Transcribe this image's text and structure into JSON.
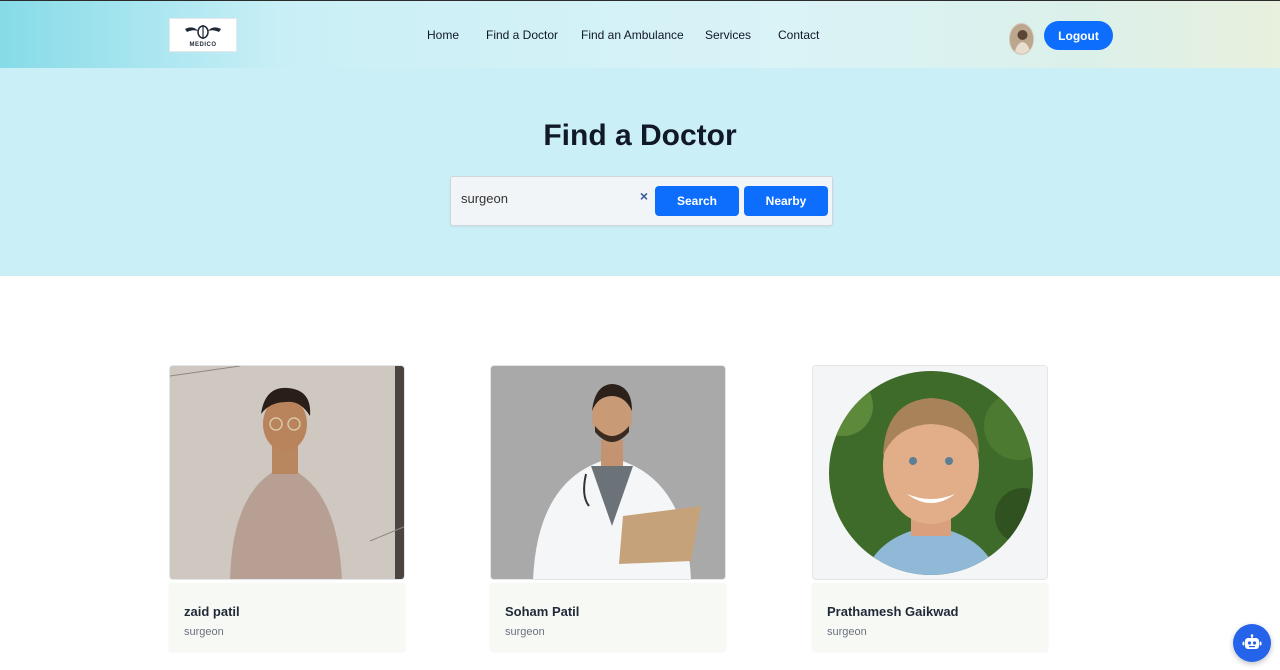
{
  "nav": {
    "logo_text": "MEDICO",
    "links": [
      "Home",
      "Find a Doctor",
      "Find an Ambulance",
      "Services",
      "Contact"
    ],
    "logout_label": "Logout"
  },
  "hero": {
    "title": "Find a Doctor",
    "search_value": "surgeon",
    "clear_glyph": "×",
    "search_label": "Search",
    "nearby_label": "Nearby"
  },
  "doctors": [
    {
      "name": "zaid patil",
      "specialty": "surgeon"
    },
    {
      "name": "Soham Patil",
      "specialty": "surgeon"
    },
    {
      "name": "Prathamesh Gaikwad",
      "specialty": "surgeon"
    }
  ],
  "colors": {
    "accent": "#0d6efd",
    "hero_bg": "#cbeff6",
    "card_info_bg": "#f6f9f4"
  },
  "icons": [
    "logo-emblem-icon",
    "avatar",
    "close-icon",
    "robot-icon"
  ]
}
